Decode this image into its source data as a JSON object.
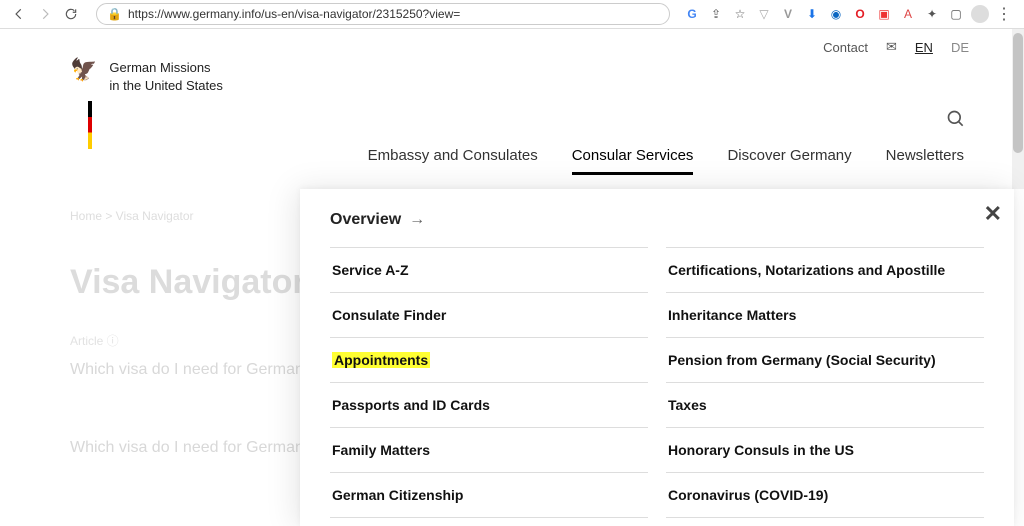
{
  "browser": {
    "url": "https://www.germany.info/us-en/visa-navigator/2315250?view="
  },
  "topbar": {
    "contact": "Contact",
    "lang_en": "EN",
    "lang_de": "DE"
  },
  "brand": {
    "line1": "German Missions",
    "line2": "in the United States"
  },
  "nav": {
    "embassy": "Embassy and Consulates",
    "consular": "Consular Services",
    "discover": "Discover Germany",
    "newsletters": "Newsletters"
  },
  "bg": {
    "crumbs": "Home > Visa Navigator",
    "title": "Visa Navigator",
    "label": "Article ⓘ",
    "question": "Which visa do I need for Germany?",
    "question2": "Which visa do I need for Germany?"
  },
  "menu": {
    "overview": "Overview",
    "left": [
      "Service A-Z",
      "Consulate Finder",
      "Appointments",
      "Passports and ID Cards",
      "Family Matters",
      "German Citizenship"
    ],
    "right": [
      "Certifications, Notarizations and Apostille",
      "Inheritance Matters",
      "Pension from Germany (Social Security)",
      "Taxes",
      "Honorary Consuls in the US",
      "Coronavirus (COVID-19)"
    ],
    "highlighted_index": 2
  }
}
